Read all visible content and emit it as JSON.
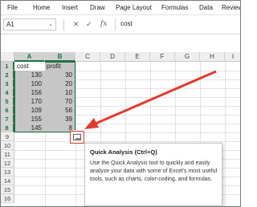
{
  "ribbon": {
    "tabs": [
      "File",
      "Home",
      "Insert",
      "Draw",
      "Page Layout",
      "Formulas",
      "Data",
      "Review"
    ]
  },
  "formula_bar": {
    "name_box": "A1",
    "name_box_caret": "⌄",
    "cancel_icon": "✕",
    "enter_icon": "✓",
    "function_icon": "fx",
    "value": "cost"
  },
  "columns": [
    "A",
    "B",
    "C",
    "D",
    "E",
    "F",
    "G",
    "H",
    "I"
  ],
  "rows": [
    "1",
    "2",
    "3",
    "4",
    "5",
    "6",
    "7",
    "8",
    "9",
    "10",
    "11",
    "12",
    "13",
    "14",
    "15",
    "16"
  ],
  "table": {
    "headers": [
      "cost",
      "profit"
    ],
    "data": [
      [
        "130",
        "30"
      ],
      [
        "100",
        "20"
      ],
      [
        "156",
        "10"
      ],
      [
        "170",
        "70"
      ],
      [
        "109",
        "56"
      ],
      [
        "155",
        "39"
      ],
      [
        "145",
        "8"
      ]
    ]
  },
  "quick_analysis": {
    "icon": "quick-analysis-icon",
    "tooltip_title": "Quick Analysis (Ctrl+Q)",
    "tooltip_body": "Use the Quick Analysis tool to quickly and easily analyze your data with some of Excel's most useful tools, such as charts, color-coding, and formulas."
  },
  "colors": {
    "selection_border": "#217346",
    "annotation": "#e33a2f",
    "selection_fill": "#c6c6c6"
  }
}
